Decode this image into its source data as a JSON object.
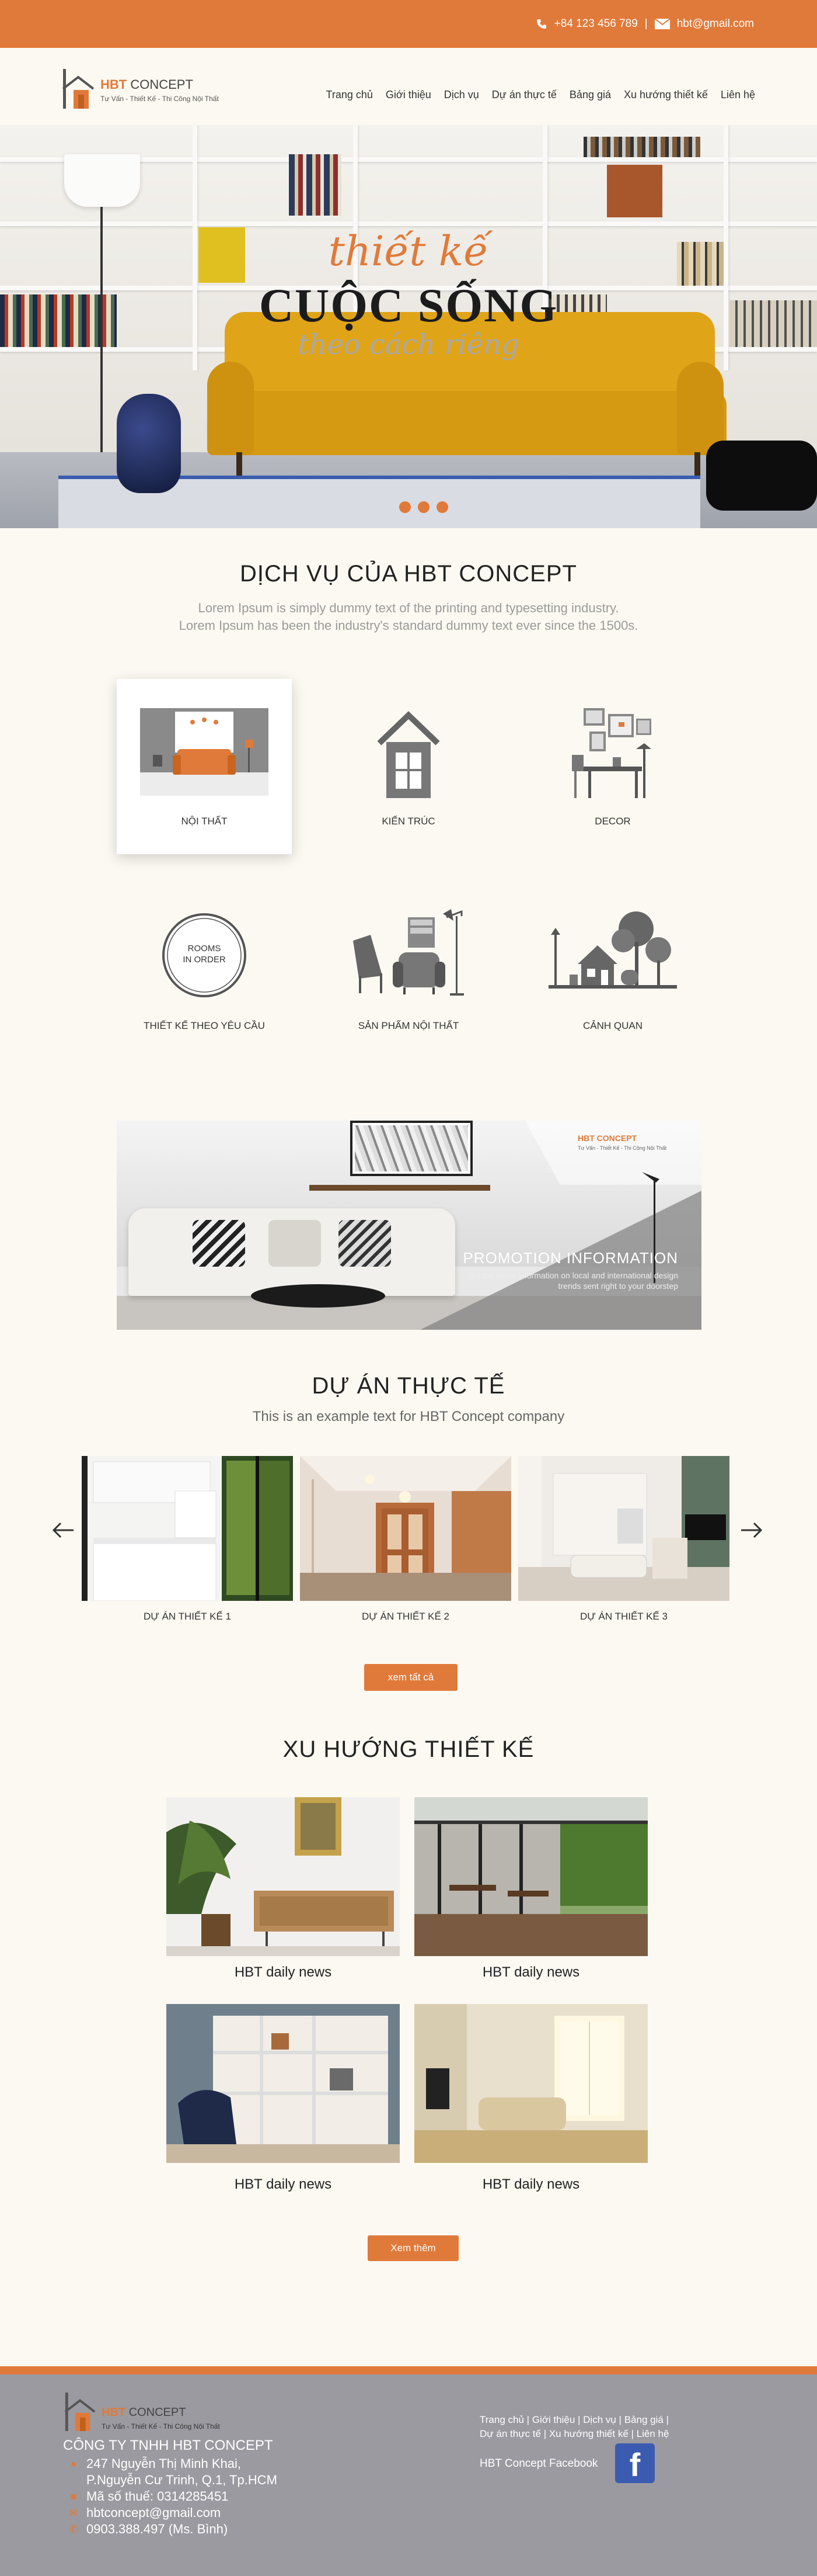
{
  "topbar": {
    "phone": "+84 123 456 789",
    "separator": "|",
    "email": "hbt@gmail.com",
    "color": "#e07a3a"
  },
  "header": {
    "logo": {
      "brand": "HBT",
      "brand_rest": "CONCEPT",
      "tagline": "Tư Vấn - Thiết Kế - Thi Công Nội Thất"
    },
    "nav": [
      {
        "label": "Trang chủ"
      },
      {
        "label": "Giới thiệu"
      },
      {
        "label": "Dịch vụ"
      },
      {
        "label": "Dự án thực tế"
      },
      {
        "label": "Bảng giá"
      },
      {
        "label": "Xu hướng thiết kế"
      },
      {
        "label": "Liên hệ"
      }
    ]
  },
  "hero": {
    "script_text": "thiết kế",
    "main_text": "CUỘC SỐNG",
    "sub_text": "theo cách riêng",
    "slide_count": 3
  },
  "services": {
    "title": "DỊCH VỤ CỦA HBT CONCEPT",
    "desc_line1": "Lorem Ipsum is simply dummy text of the printing and typesetting industry.",
    "desc_line2": "Lorem Ipsum has been the industry's standard dummy text ever since the 1500s.",
    "items": [
      {
        "label": "NỘI THẤT",
        "icon": "interior-room-icon"
      },
      {
        "label": "KIẾN TRÚC",
        "icon": "house-icon"
      },
      {
        "label": "DECOR",
        "icon": "decor-frames-icon"
      },
      {
        "label": "THIẾT KẾ THEO YÊU CẦU",
        "icon": "rooms-in-order-icon",
        "badge_line1": "ROOMS",
        "badge_line2": "IN ORDER"
      },
      {
        "label": "SẢN PHẨM NỘI THẤT",
        "icon": "furniture-chairs-icon"
      },
      {
        "label": "CẢNH QUAN",
        "icon": "landscape-house-tree-icon"
      }
    ]
  },
  "promo": {
    "title": "PROMOTION INFORMATION",
    "text": "Get the latest information on local and international design trends sent right to your doorstep",
    "logo_brand": "HBT CONCEPT",
    "logo_tag": "Tư Vấn - Thiết Kế - Thi Công Nội Thất"
  },
  "projects": {
    "title": "DỰ ÁN THỰC TẾ",
    "subtitle": "This is an example text for HBT Concept company",
    "items": [
      {
        "label": "DỰ ÁN THIẾT KẾ 1"
      },
      {
        "label": "DỰ ÁN THIẾT KẾ 2"
      },
      {
        "label": "DỰ ÁN THIẾT KẾ 3"
      }
    ],
    "more_button": "xem tất cả"
  },
  "trends": {
    "title": "XU HƯỚNG THIẾT KẾ",
    "items": [
      {
        "label": "HBT daily news"
      },
      {
        "label": "HBT daily news"
      },
      {
        "label": "HBT daily news"
      },
      {
        "label": "HBT daily news"
      }
    ],
    "more_button": "Xem thêm"
  },
  "footer": {
    "logo_brand": "HBT",
    "logo_brand_rest": "CONCEPT",
    "logo_tag": "Tư Vấn - Thiết Kế - Thi Công Nội Thất",
    "company": "CÔNG TY TNHH HBT CONCEPT",
    "address_line1": "247 Nguyễn Thị Minh Khai,",
    "address_line2": "P.Nguyễn Cư Trinh, Q.1, Tp.HCM",
    "tax": "Mã số thuế: 0314285451",
    "email": "hbtconcept@gmail.com",
    "phone": "0903.388.497 (Ms. Bình)",
    "links_line1": "Trang chủ | Giới thiệu | Dịch vụ | Bảng giá |",
    "links_line2": "Dự án thực tế | Xu hướng thiết kế | Liên hệ",
    "facebook_label": "HBT Concept Facebook",
    "facebook_glyph": "f"
  }
}
